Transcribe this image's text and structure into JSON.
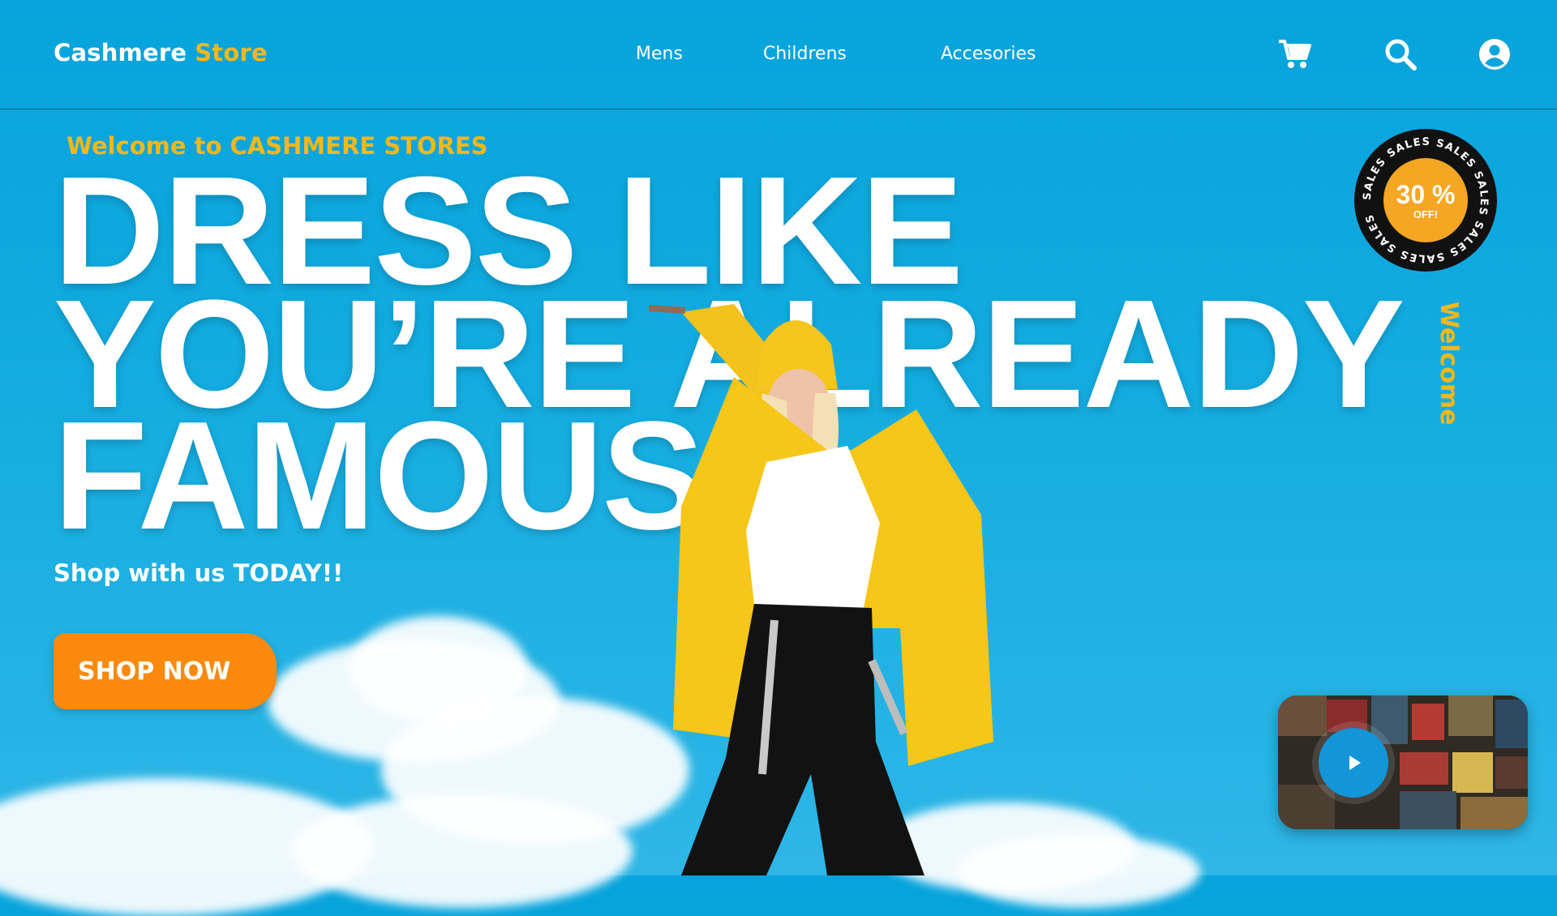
{
  "brand": {
    "name": "Cashmere",
    "accent": "Store"
  },
  "nav": {
    "mens": "Mens",
    "childrens": "Childrens",
    "accesories": "Accesories"
  },
  "hero": {
    "welcome": "Welcome to CASHMERE STORES",
    "headline_line1": "DRESS LIKE",
    "headline_line2": "YOU’RE ALREADY",
    "headline_line3": "FAMOUS",
    "tagline": "Shop with us TODAY!!",
    "cta": "SHOP NOW",
    "vertical_text": "Welcome"
  },
  "badge": {
    "discount": "30 %",
    "label": "OFF!",
    "ring_text": "SALES SALES SALES SALES SALES SALES SALES "
  },
  "icons": [
    "cart-icon",
    "search-icon",
    "user-icon",
    "play-icon"
  ],
  "colors": {
    "background": "#0aa6de",
    "accent_yellow": "#f5b81a",
    "button_orange": "#fa8a0e",
    "play_blue": "#1495d8",
    "badge_black": "#111111"
  }
}
